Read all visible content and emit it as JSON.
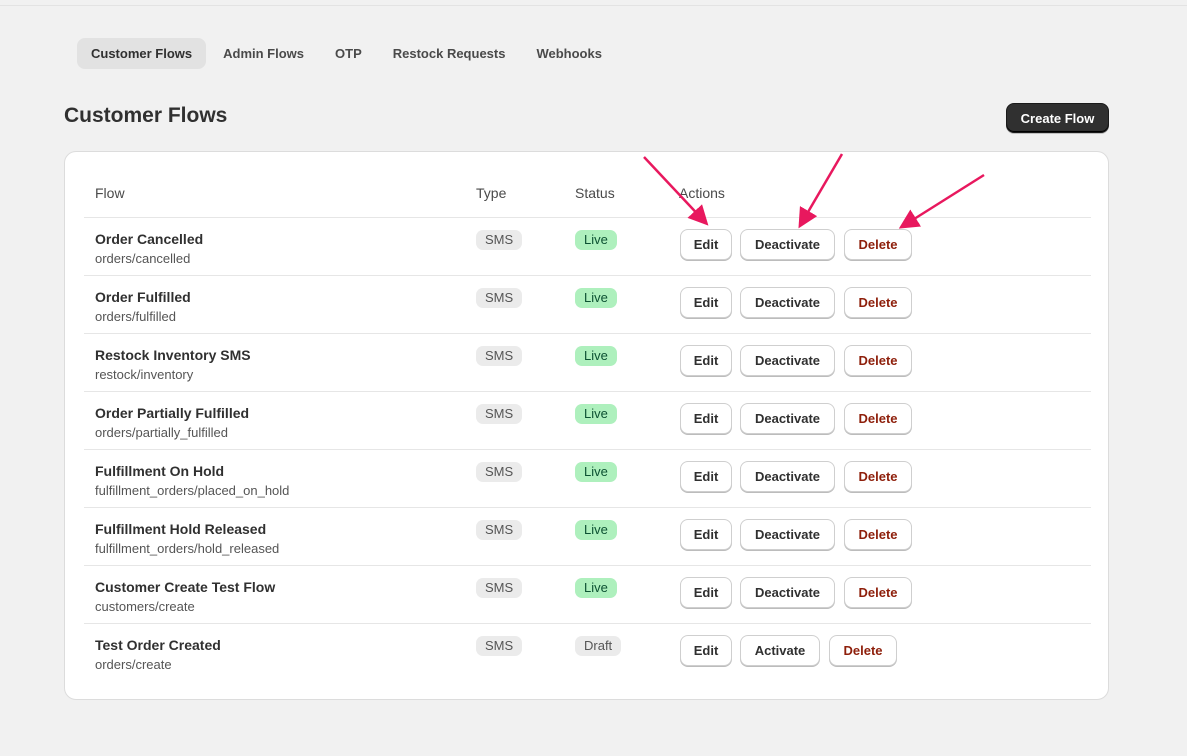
{
  "tabs": [
    {
      "label": "Customer Flows",
      "active": true
    },
    {
      "label": "Admin Flows",
      "active": false
    },
    {
      "label": "OTP",
      "active": false
    },
    {
      "label": "Restock Requests",
      "active": false
    },
    {
      "label": "Webhooks",
      "active": false
    }
  ],
  "page": {
    "title": "Customer Flows",
    "create_button": "Create Flow"
  },
  "table": {
    "columns": [
      "Flow",
      "Type",
      "Status",
      "Actions"
    ],
    "rows": [
      {
        "name": "Order Cancelled",
        "topic": "orders/cancelled",
        "type": "SMS",
        "status": "Live",
        "toggle": "Deactivate",
        "edit": "Edit",
        "delete": "Delete"
      },
      {
        "name": "Order Fulfilled",
        "topic": "orders/fulfilled",
        "type": "SMS",
        "status": "Live",
        "toggle": "Deactivate",
        "edit": "Edit",
        "delete": "Delete"
      },
      {
        "name": "Restock Inventory SMS",
        "topic": "restock/inventory",
        "type": "SMS",
        "status": "Live",
        "toggle": "Deactivate",
        "edit": "Edit",
        "delete": "Delete"
      },
      {
        "name": "Order Partially Fulfilled",
        "topic": "orders/partially_fulfilled",
        "type": "SMS",
        "status": "Live",
        "toggle": "Deactivate",
        "edit": "Edit",
        "delete": "Delete"
      },
      {
        "name": "Fulfillment On Hold",
        "topic": "fulfillment_orders/placed_on_hold",
        "type": "SMS",
        "status": "Live",
        "toggle": "Deactivate",
        "edit": "Edit",
        "delete": "Delete"
      },
      {
        "name": "Fulfillment Hold Released",
        "topic": "fulfillment_orders/hold_released",
        "type": "SMS",
        "status": "Live",
        "toggle": "Deactivate",
        "edit": "Edit",
        "delete": "Delete"
      },
      {
        "name": "Customer Create Test Flow",
        "topic": "customers/create",
        "type": "SMS",
        "status": "Live",
        "toggle": "Deactivate",
        "edit": "Edit",
        "delete": "Delete"
      },
      {
        "name": "Test Order Created",
        "topic": "orders/create",
        "type": "SMS",
        "status": "Draft",
        "toggle": "Activate",
        "edit": "Edit",
        "delete": "Delete"
      }
    ]
  },
  "colors": {
    "background": "#f1f1f1",
    "primary_button": "#303030",
    "live_badge": "#aef0bd",
    "delete_text": "#8e1f0b",
    "annotation_arrow": "#e8185e"
  }
}
